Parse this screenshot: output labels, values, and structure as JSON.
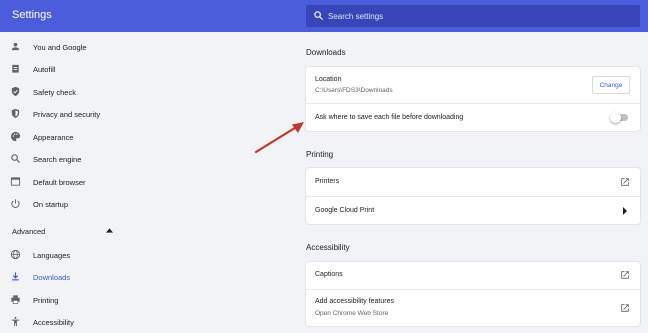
{
  "header": {
    "title": "Settings",
    "search_placeholder": "Search settings"
  },
  "sidebar": {
    "items": [
      {
        "label": "You and Google",
        "icon": "person-icon"
      },
      {
        "label": "Autofill",
        "icon": "clipboard-icon"
      },
      {
        "label": "Safety check",
        "icon": "shield-check-icon"
      },
      {
        "label": "Privacy and security",
        "icon": "shield-icon"
      },
      {
        "label": "Appearance",
        "icon": "palette-icon"
      },
      {
        "label": "Search engine",
        "icon": "search-icon"
      },
      {
        "label": "Default browser",
        "icon": "browser-icon"
      },
      {
        "label": "On startup",
        "icon": "power-icon"
      }
    ],
    "advanced_label": "Advanced",
    "advanced_items": [
      {
        "label": "Languages",
        "icon": "globe-icon"
      },
      {
        "label": "Downloads",
        "icon": "download-icon",
        "active": true
      },
      {
        "label": "Printing",
        "icon": "printer-icon"
      },
      {
        "label": "Accessibility",
        "icon": "accessibility-icon"
      }
    ]
  },
  "downloads": {
    "title": "Downloads",
    "location_label": "Location",
    "location_value": "C:\\Users\\FDS3\\Downloads",
    "change_label": "Change",
    "ask_label": "Ask where to save each file before downloading",
    "ask_enabled": false
  },
  "printing": {
    "title": "Printing",
    "printers_label": "Printers",
    "cloud_print_label": "Google Cloud Print"
  },
  "accessibility": {
    "title": "Accessibility",
    "captions_label": "Captions",
    "add_features_label": "Add accessibility features",
    "add_features_sub": "Open Chrome Web Store"
  },
  "colors": {
    "header": "#4c5ddb",
    "search_bg": "#3645b8",
    "accent": "#3b5bdb",
    "annotation_arrow": "#c0392b"
  }
}
